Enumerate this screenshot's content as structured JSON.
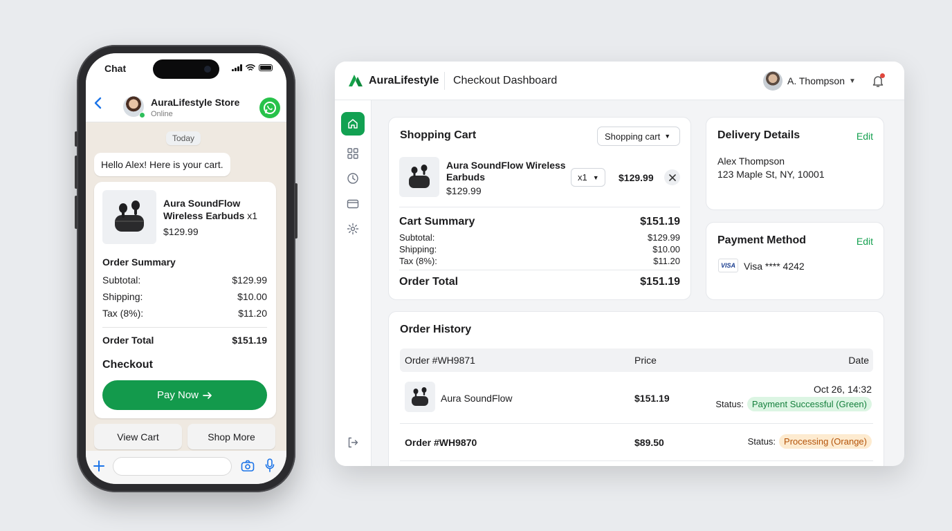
{
  "phone": {
    "status_time": "Chat",
    "chat_header": {
      "name": "AuraLifestyle Store",
      "status": "Online"
    },
    "date_chip": "Today",
    "greeting": "Hello Alex! Here is your cart.",
    "cart": {
      "product_name": "Aura SoundFlow Wireless Earbuds",
      "quantity": "x1",
      "price": "$129.99",
      "summary_title": "Order Summary",
      "rows": [
        {
          "label": "Subtotal:",
          "value": "$129.99"
        },
        {
          "label": "Shipping:",
          "value": "$10.00"
        },
        {
          "label": "Tax (8%):",
          "value": "$11.20"
        }
      ],
      "total_label": "Order Total",
      "total_value": "$151.19",
      "checkout_label": "Checkout",
      "pay_button": "Pay Now"
    },
    "quick_replies": [
      "View Cart",
      "Shop More"
    ]
  },
  "dashboard": {
    "brand": "AuraLifestyle",
    "title": "Checkout Dashboard",
    "user": "A. Thompson",
    "accent": "#12a152",
    "sidebar_icons": [
      "home-icon",
      "grid-icon",
      "clock-icon",
      "card-icon",
      "settings-icon",
      "logout-icon"
    ],
    "cart": {
      "title": "Shopping Cart",
      "select_value": "Shopping cart",
      "item": {
        "name": "Aura SoundFlow Wireless Earbuds",
        "price": "$129.99",
        "qty": "x1",
        "line_total": "$129.99"
      },
      "summary_title": "Cart Summary",
      "summary_total": "$151.19",
      "rows": [
        {
          "label": "Subtotal:",
          "value": "$129.99"
        },
        {
          "label": "Shipping:",
          "value": "$10.00"
        },
        {
          "label": "Tax (8%):",
          "value": "$11.20"
        }
      ],
      "order_total_label": "Order Total",
      "order_total_value": "$151.19"
    },
    "delivery": {
      "title": "Delivery Details",
      "edit": "Edit",
      "name": "Alex Thompson",
      "address": "123 Maple St, NY, 10001"
    },
    "payment": {
      "title": "Payment Method",
      "edit": "Edit",
      "card_brand": "VISA",
      "card": "Visa **** 4242"
    },
    "history": {
      "title": "Order History",
      "columns": [
        "Order #WH9871",
        "Price",
        "Date"
      ],
      "rows": [
        {
          "product": "Aura SoundFlow",
          "price": "$151.19",
          "date": "Oct 26, 14:32",
          "status_label": "Status:",
          "status": "Payment Successful (Green)"
        },
        {
          "order": "Order #WH9870",
          "price": "$89.50",
          "status_label": "Status:",
          "status": "Processing (Orange)"
        }
      ]
    }
  }
}
